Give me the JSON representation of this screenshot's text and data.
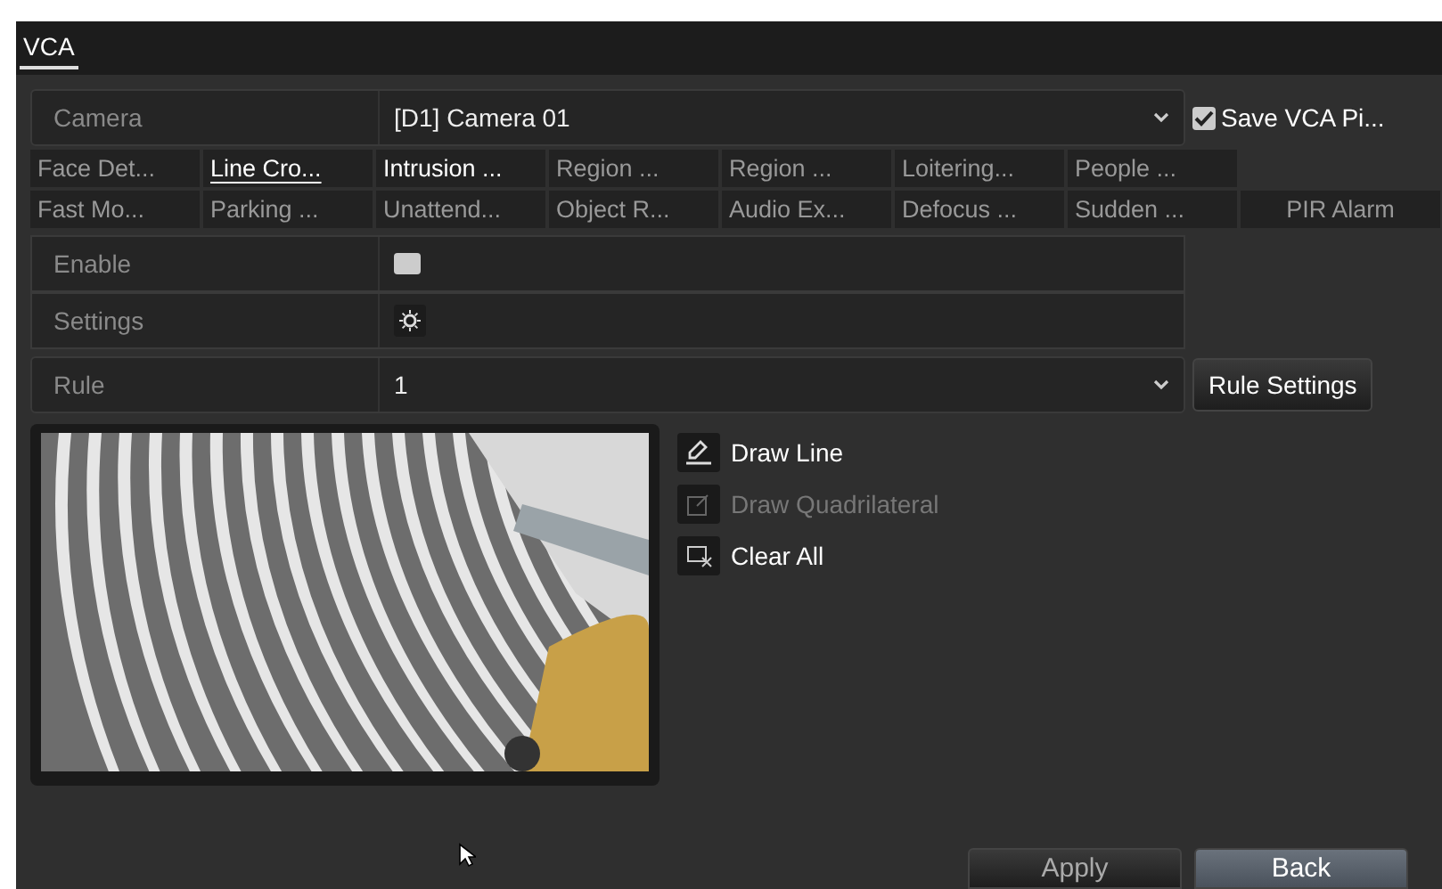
{
  "header": {
    "tab": "VCA"
  },
  "camera": {
    "label": "Camera",
    "value": "[D1] Camera 01",
    "save_pictures": {
      "label": "Save VCA Pi...",
      "checked": true
    }
  },
  "function_tabs": [
    [
      {
        "label": "Face Det...",
        "selected": false,
        "enabled": false
      },
      {
        "label": "Line Cro...",
        "selected": true,
        "enabled": true
      },
      {
        "label": "Intrusion ...",
        "selected": false,
        "enabled": true
      },
      {
        "label": "Region ...",
        "selected": false,
        "enabled": false
      },
      {
        "label": "Region ...",
        "selected": false,
        "enabled": false
      },
      {
        "label": "Loitering...",
        "selected": false,
        "enabled": false
      },
      {
        "label": "People ...",
        "selected": false,
        "enabled": false
      }
    ],
    [
      {
        "label": "Fast Mo...",
        "selected": false,
        "enabled": false
      },
      {
        "label": "Parking ...",
        "selected": false,
        "enabled": false
      },
      {
        "label": "Unattend...",
        "selected": false,
        "enabled": false
      },
      {
        "label": "Object R...",
        "selected": false,
        "enabled": false
      },
      {
        "label": "Audio Ex...",
        "selected": false,
        "enabled": false
      },
      {
        "label": "Defocus ...",
        "selected": false,
        "enabled": false
      },
      {
        "label": "Sudden ...",
        "selected": false,
        "enabled": false
      },
      {
        "label": "PIR Alarm",
        "selected": false,
        "enabled": false
      }
    ]
  ],
  "enable": {
    "label": "Enable",
    "checked": false
  },
  "settings": {
    "label": "Settings"
  },
  "rule": {
    "label": "Rule",
    "value": "1",
    "button": "Rule Settings"
  },
  "preview": {
    "kind": "picture"
  },
  "draw_tools": [
    {
      "kind": "line",
      "label": "Draw Line",
      "disabled": false
    },
    {
      "kind": "quad",
      "label": "Draw Quadrilateral",
      "disabled": true
    },
    {
      "kind": "clear",
      "label": "Clear All",
      "disabled": false
    }
  ],
  "buttons": [
    {
      "label": "Apply",
      "primary": false
    },
    {
      "label": "Back",
      "primary": true
    }
  ]
}
